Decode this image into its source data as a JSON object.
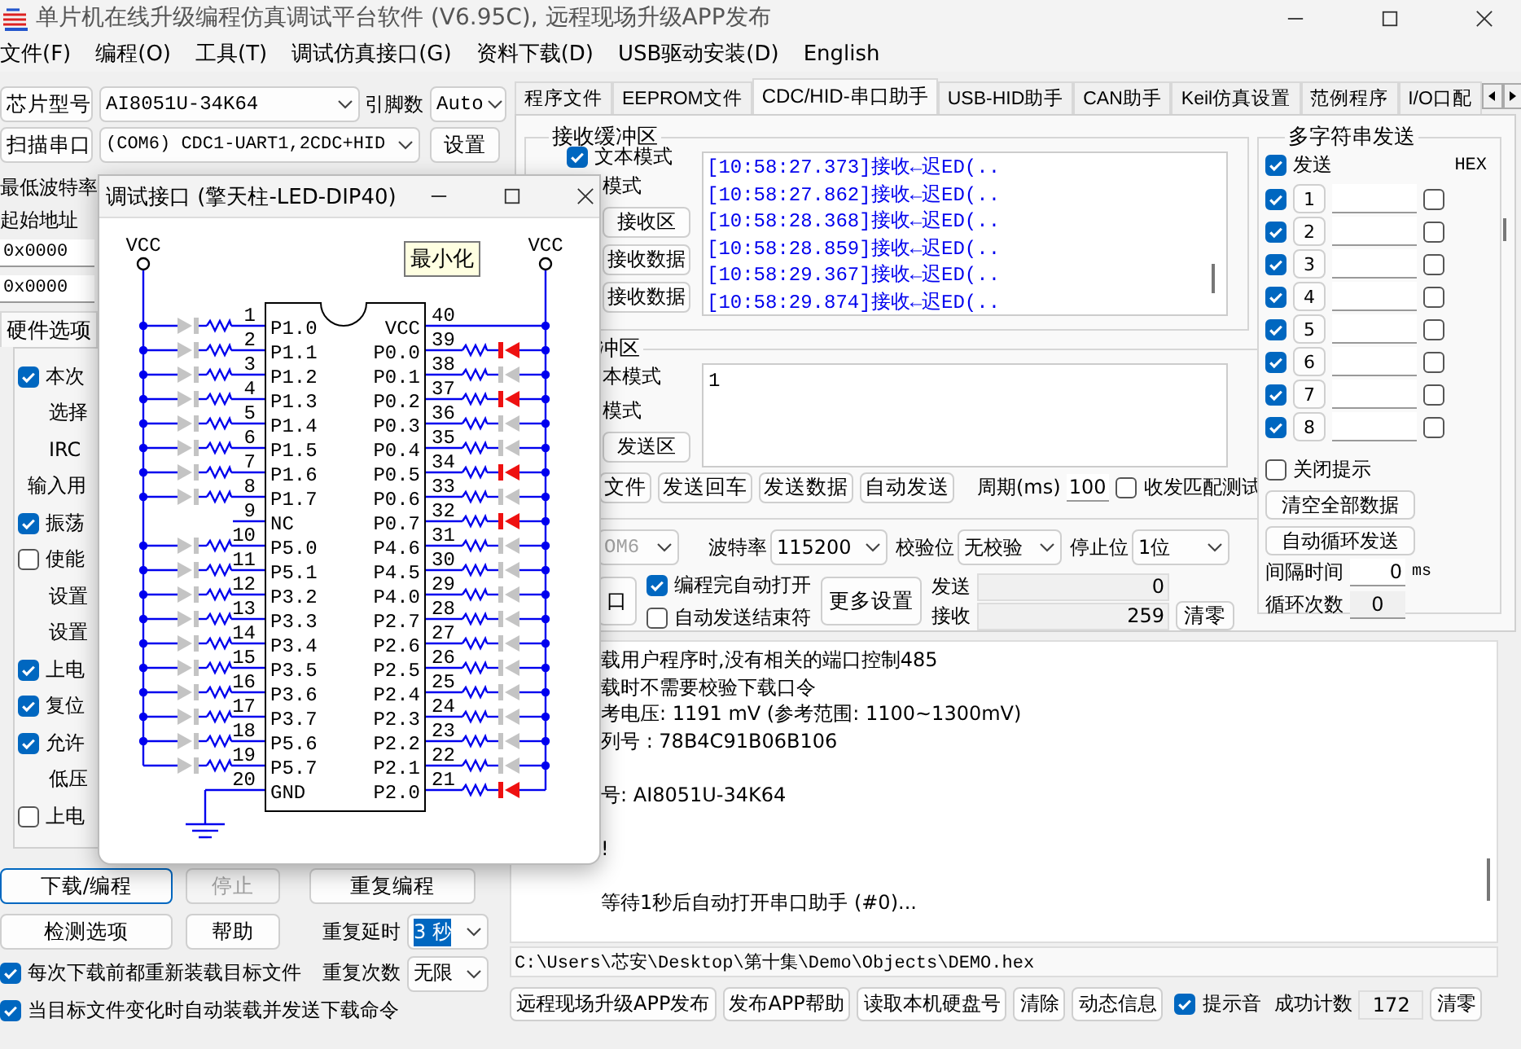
{
  "window": {
    "title": "单片机在线升级编程仿真调试平台软件 (V6.95C), 远程现场升级APP发布"
  },
  "menu": [
    "文件(F)",
    "编程(O)",
    "工具(T)",
    "调试仿真接口(G)",
    "资料下载(D)",
    "USB驱动安装(D)",
    "English"
  ],
  "chip_row": {
    "button": "芯片型号",
    "chip": "AI8051U-34K64",
    "pins_label": "引脚数",
    "pins": "Auto"
  },
  "port_row": {
    "button": "扫描串口",
    "port": "(COM6) CDC1-UART1,2CDC+HID",
    "settings": "设置"
  },
  "baud_label": "最低波特率",
  "address": {
    "label": "起始地址",
    "values": [
      "0x0000",
      "0x0000"
    ]
  },
  "options_tab": {
    "label": "硬件选项",
    "selected": true
  },
  "options": [
    {
      "kind": "check",
      "label": "本次",
      "checked": true
    },
    {
      "kind": "text",
      "label": "选择"
    },
    {
      "kind": "text",
      "label": "IRC"
    },
    {
      "kind": "heading",
      "label": "输入用"
    },
    {
      "kind": "check",
      "label": "振荡",
      "checked": true
    },
    {
      "kind": "check",
      "label": "使能",
      "checked": false
    },
    {
      "kind": "text",
      "label": "设置"
    },
    {
      "kind": "text",
      "label": "设置"
    },
    {
      "kind": "check",
      "label": "上电",
      "checked": true
    },
    {
      "kind": "check",
      "label": "复位",
      "checked": true
    },
    {
      "kind": "check",
      "label": "允许",
      "checked": true
    },
    {
      "kind": "text",
      "label": "低压"
    },
    {
      "kind": "check",
      "label": "上电",
      "checked": false
    }
  ],
  "program_buttons": [
    {
      "label": "下载/编程",
      "disabled": false,
      "focused": true
    },
    {
      "label": "停止",
      "disabled": true,
      "focused": false
    },
    {
      "label": "重复编程",
      "disabled": false,
      "focused": false
    }
  ],
  "help_buttons": [
    "检测选项",
    "帮助"
  ],
  "repeat_delay": {
    "label": "重复延时",
    "value": "3 秒",
    "highlighted": true
  },
  "repeat_count": {
    "label": "重复次数",
    "value": "无限",
    "highlighted": false
  },
  "auto_options": [
    {
      "label": "每次下载前都重新装载目标文件",
      "checked": true
    },
    {
      "label": "当目标文件变化时自动装载并发送下载命令",
      "checked": true
    }
  ],
  "tabs": [
    {
      "label": "程序文件",
      "selected": false
    },
    {
      "label": "EEPROM文件",
      "selected": false
    },
    {
      "label": "CDC/HID-串口助手",
      "selected": true
    },
    {
      "label": "USB-HID助手",
      "selected": false
    },
    {
      "label": "CAN助手",
      "selected": false
    },
    {
      "label": "Keil仿真设置",
      "selected": false
    },
    {
      "label": "范例程序",
      "selected": false
    },
    {
      "label": "I/O口配",
      "selected": false
    }
  ],
  "receive": {
    "title": "接收缓冲区",
    "text_mode": {
      "label": "文本模式",
      "checked": true
    },
    "hex_mode_label": "模式",
    "buttons": [
      "接收区",
      "接收数据",
      "接收数据"
    ],
    "lines": [
      "[10:58:27.373]接收←迟ED(..",
      "[10:58:27.862]接收←迟ED(..",
      "[10:58:28.368]接收←迟ED(..",
      "[10:58:28.859]接收←迟ED(..",
      "[10:58:29.367]接收←迟ED(..",
      "[10:58:29.874]接收←迟ED(.."
    ]
  },
  "send": {
    "title": "冲区",
    "mode_labels": [
      "本模式",
      "模式"
    ],
    "clear": "发送区",
    "text": "1",
    "buttons": [
      "文件",
      "发送回车",
      "发送数据",
      "自动发送"
    ],
    "period_label": "周期(ms)",
    "period": "100",
    "match": {
      "label": "收发匹配测试",
      "checked": false
    }
  },
  "serial": {
    "port": "OM6",
    "port_disabled": true,
    "baud_label": "波特率",
    "baud": "115200",
    "parity_label": "校验位",
    "parity": "无校验",
    "stop_label": "停止位",
    "stop": "1位"
  },
  "port_controls": {
    "open": "口",
    "auto_open": {
      "label": "编程完自动打开",
      "checked": true
    },
    "end_char": {
      "label": "自动发送结束符",
      "checked": false
    },
    "more": "更多设置",
    "sent_label": "发送",
    "sent": "0",
    "recv_label": "接收",
    "recv": "259",
    "clear": "清零"
  },
  "multi_send": {
    "title": "多字符串发送",
    "send_all": {
      "label": "发送",
      "checked": true
    },
    "hex_label": "HEX",
    "rows": [
      {
        "number": "1",
        "checked": true,
        "hex": false
      },
      {
        "number": "2",
        "checked": true,
        "hex": false
      },
      {
        "number": "3",
        "checked": true,
        "hex": false
      },
      {
        "number": "4",
        "checked": true,
        "hex": false
      },
      {
        "number": "5",
        "checked": true,
        "hex": false
      },
      {
        "number": "6",
        "checked": true,
        "hex": false
      },
      {
        "number": "7",
        "checked": true,
        "hex": false
      },
      {
        "number": "8",
        "checked": true,
        "hex": false
      }
    ],
    "close_tips": {
      "label": "关闭提示",
      "checked": false
    },
    "clear_all": "清空全部数据",
    "auto_loop": "自动循环发送",
    "interval_label": "间隔时间",
    "interval": "0",
    "interval_unit": "ms",
    "loop_label": "循环次数",
    "loop": "0"
  },
  "log": [
    {
      "text": "载用户程序时,没有相关的端口控制485",
      "space_before": false
    },
    {
      "text": "载时不需要校验下载口令",
      "space_before": false
    },
    {
      "text": "考电压: 1191 mV (参考范围: 1100~1300mV)",
      "space_before": false
    },
    {
      "text": "列号 : 78B4C91B06B106",
      "space_before": false
    },
    {
      "text": "号: AI8051U-34K64",
      "space_before": true
    },
    {
      "text": "!",
      "space_before": true
    },
    {
      "text": "等待1秒后自动打开串口助手 (#0)...",
      "space_before": true
    }
  ],
  "path": "C:\\Users\\芯安\\Desktop\\第十集\\Demo\\Objects\\DEMO.hex",
  "footer": {
    "buttons": [
      "远程现场升级APP发布",
      "发布APP帮助",
      "读取本机硬盘号",
      "清除",
      "动态信息"
    ],
    "beep": {
      "label": "提示音",
      "checked": true
    },
    "count_label": "成功计数",
    "count": "172",
    "reset": "清零"
  },
  "dialog": {
    "title": "调试接口 (擎天柱-LED-DIP40)",
    "tooltip": "最小化",
    "vcc": [
      "VCC",
      "VCC"
    ],
    "left_pins": [
      {
        "number": "1",
        "name": "P1.0",
        "kind": "led",
        "lit": false
      },
      {
        "number": "2",
        "name": "P1.1",
        "kind": "led",
        "lit": false
      },
      {
        "number": "3",
        "name": "P1.2",
        "kind": "led",
        "lit": false
      },
      {
        "number": "4",
        "name": "P1.3",
        "kind": "led",
        "lit": false
      },
      {
        "number": "5",
        "name": "P1.4",
        "kind": "led",
        "lit": false
      },
      {
        "number": "6",
        "name": "P1.5",
        "kind": "led",
        "lit": false
      },
      {
        "number": "7",
        "name": "P1.6",
        "kind": "led",
        "lit": false
      },
      {
        "number": "8",
        "name": "P1.7",
        "kind": "led",
        "lit": false
      },
      {
        "number": "9",
        "name": "NC",
        "kind": "nc"
      },
      {
        "number": "10",
        "name": "P5.0",
        "kind": "led",
        "lit": false
      },
      {
        "number": "11",
        "name": "P5.1",
        "kind": "led",
        "lit": false
      },
      {
        "number": "12",
        "name": "P3.2",
        "kind": "led",
        "lit": false
      },
      {
        "number": "13",
        "name": "P3.3",
        "kind": "led",
        "lit": false
      },
      {
        "number": "14",
        "name": "P3.4",
        "kind": "led",
        "lit": false
      },
      {
        "number": "15",
        "name": "P3.5",
        "kind": "led",
        "lit": false
      },
      {
        "number": "16",
        "name": "P3.6",
        "kind": "led",
        "lit": false
      },
      {
        "number": "17",
        "name": "P3.7",
        "kind": "led",
        "lit": false
      },
      {
        "number": "18",
        "name": "P5.6",
        "kind": "led",
        "lit": false
      },
      {
        "number": "19",
        "name": "P5.7",
        "kind": "led",
        "lit": false
      },
      {
        "number": "20",
        "name": "GND",
        "kind": "ground"
      }
    ],
    "right_pins": [
      {
        "number": "40",
        "name": "VCC",
        "kind": "supply"
      },
      {
        "number": "39",
        "name": "P0.0",
        "kind": "led",
        "lit": true
      },
      {
        "number": "38",
        "name": "P0.1",
        "kind": "led",
        "lit": false
      },
      {
        "number": "37",
        "name": "P0.2",
        "kind": "led",
        "lit": true
      },
      {
        "number": "36",
        "name": "P0.3",
        "kind": "led",
        "lit": false
      },
      {
        "number": "35",
        "name": "P0.4",
        "kind": "led",
        "lit": false
      },
      {
        "number": "34",
        "name": "P0.5",
        "kind": "led",
        "lit": true
      },
      {
        "number": "33",
        "name": "P0.6",
        "kind": "led",
        "lit": false
      },
      {
        "number": "32",
        "name": "P0.7",
        "kind": "led",
        "lit": true
      },
      {
        "number": "31",
        "name": "P4.6",
        "kind": "led",
        "lit": false
      },
      {
        "number": "30",
        "name": "P4.5",
        "kind": "led",
        "lit": false
      },
      {
        "number": "29",
        "name": "P4.0",
        "kind": "led",
        "lit": false
      },
      {
        "number": "28",
        "name": "P2.7",
        "kind": "led",
        "lit": false
      },
      {
        "number": "27",
        "name": "P2.6",
        "kind": "led",
        "lit": false
      },
      {
        "number": "26",
        "name": "P2.5",
        "kind": "led",
        "lit": false
      },
      {
        "number": "25",
        "name": "P2.4",
        "kind": "led",
        "lit": false
      },
      {
        "number": "24",
        "name": "P2.3",
        "kind": "led",
        "lit": false
      },
      {
        "number": "23",
        "name": "P2.2",
        "kind": "led",
        "lit": false
      },
      {
        "number": "22",
        "name": "P2.1",
        "kind": "led",
        "lit": false
      },
      {
        "number": "21",
        "name": "P2.0",
        "kind": "led",
        "lit": true
      }
    ]
  }
}
